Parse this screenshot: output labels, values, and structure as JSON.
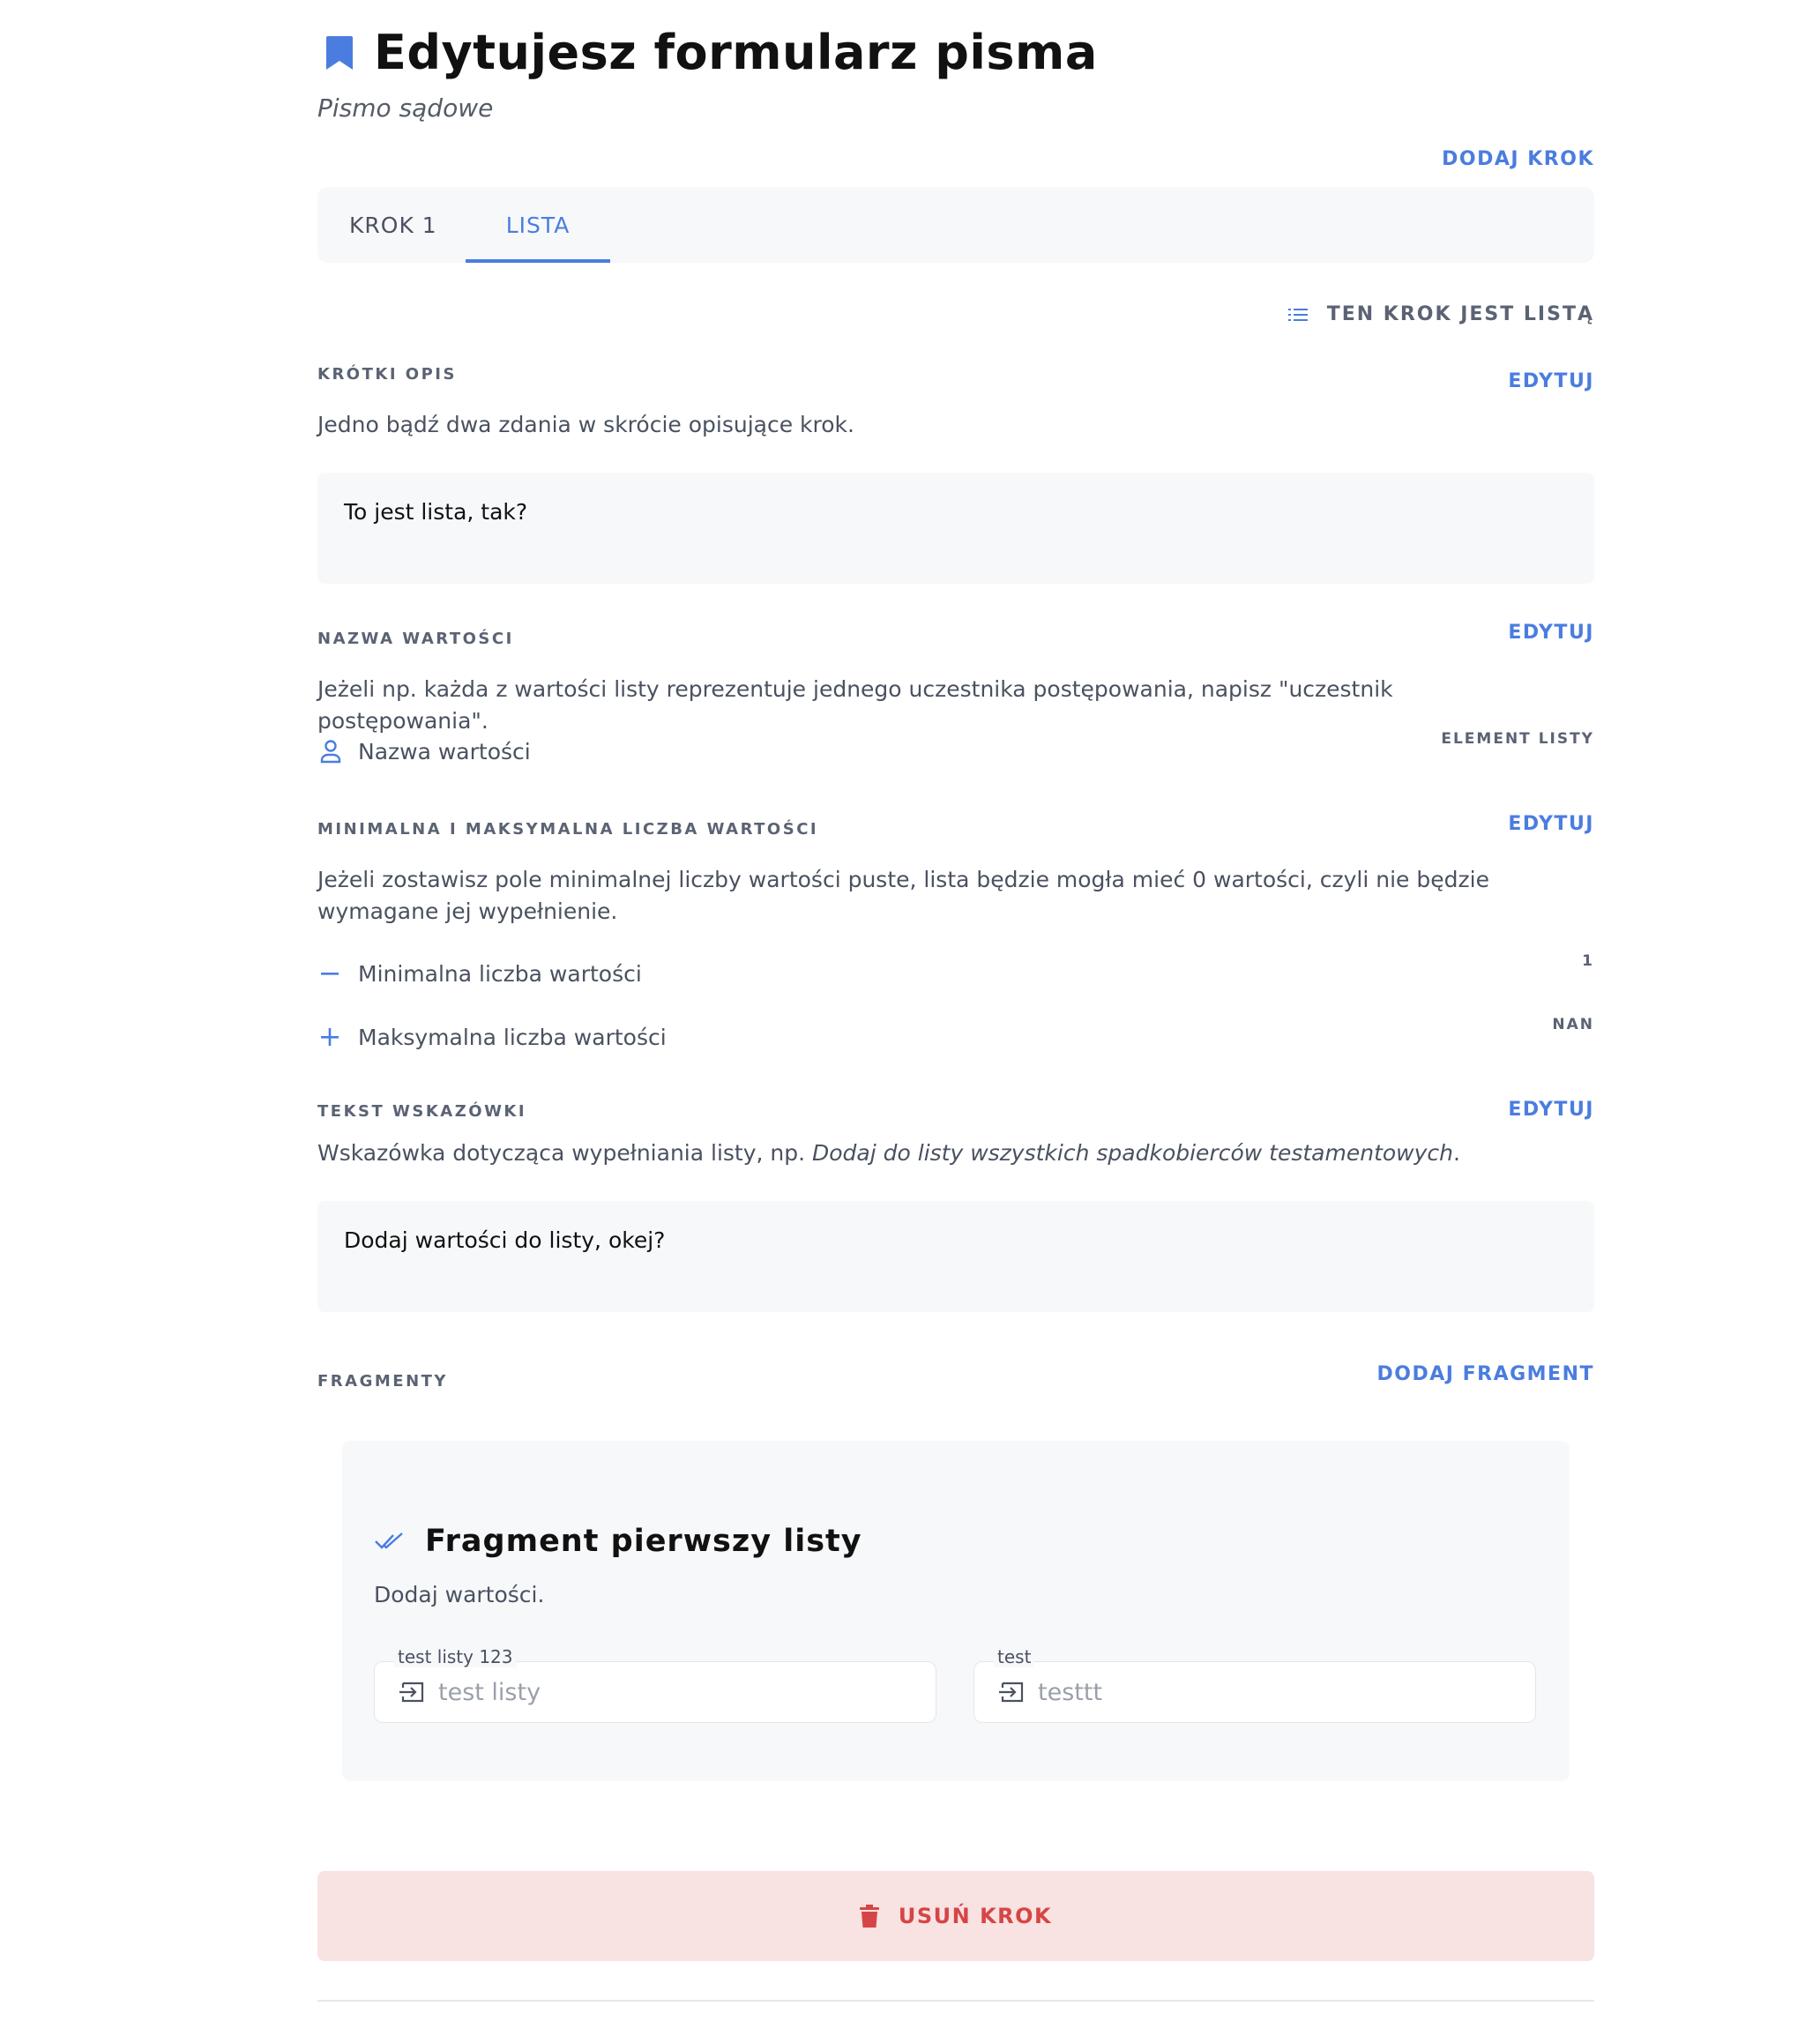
{
  "header": {
    "title": "Edytujesz formularz pisma",
    "subtitle": "Pismo sądowe",
    "add_step_label": "DODAJ KROK",
    "icon": "bookmark-icon",
    "accent_color": "#4a7ddf"
  },
  "tabs": [
    {
      "label": "KROK 1",
      "active": false
    },
    {
      "label": "LISTA",
      "active": true
    }
  ],
  "list_badge": {
    "icon": "list-icon",
    "label": "TEN KROK JEST LISTĄ"
  },
  "sections": {
    "short_desc": {
      "label": "KRÓTKI OPIS",
      "edit_label": "EDYTUJ",
      "description": "Jedno bądź dwa zdania w skrócie opisujące krok.",
      "value": "To jest lista, tak?"
    },
    "value_name": {
      "label": "NAZWA WARTOŚCI",
      "edit_label": "EDYTUJ",
      "description": "Jeżeli np. każda z wartości listy reprezentuje jednego uczestnika postępowania, napisz \"uczestnik postępowania\".",
      "prop_label": "Nazwa wartości",
      "prop_value": "ELEMENT LISTY",
      "icon": "person-icon"
    },
    "min_max": {
      "label": "MINIMALNA I MAKSYMALNA LICZBA WARTOŚCI",
      "edit_label": "EDYTUJ",
      "description": "Jeżeli zostawisz pole minimalnej liczby wartości puste, lista będzie mogła mieć 0 wartości, czyli nie będzie wymagane jej wypełnienie.",
      "min_label": "Minimalna liczba wartości",
      "min_value": "1",
      "max_label": "Maksymalna liczba wartości",
      "max_value": "NAN"
    },
    "hint": {
      "label": "TEKST WSKAZÓWKI",
      "edit_label": "EDYTUJ",
      "description_prefix": "Wskazówka dotycząca wypełniania listy, np. ",
      "description_italic": "Dodaj do listy wszystkich spadkobierców testamentowych",
      "description_suffix": ".",
      "value": "Dodaj wartości do listy, okej?"
    },
    "fragments": {
      "label": "FRAGMENTY",
      "add_label": "DODAJ FRAGMENT"
    }
  },
  "fragment": {
    "title": "Fragment pierwszy listy",
    "description": "Dodaj wartości.",
    "fields": [
      {
        "label": "test listy 123",
        "placeholder": "test listy",
        "icon": "input-icon"
      },
      {
        "label": "test",
        "placeholder": "testtt",
        "icon": "input-icon"
      }
    ]
  },
  "delete": {
    "label": "USUŃ KROK",
    "icon": "trash-icon",
    "color": "#d64545"
  }
}
